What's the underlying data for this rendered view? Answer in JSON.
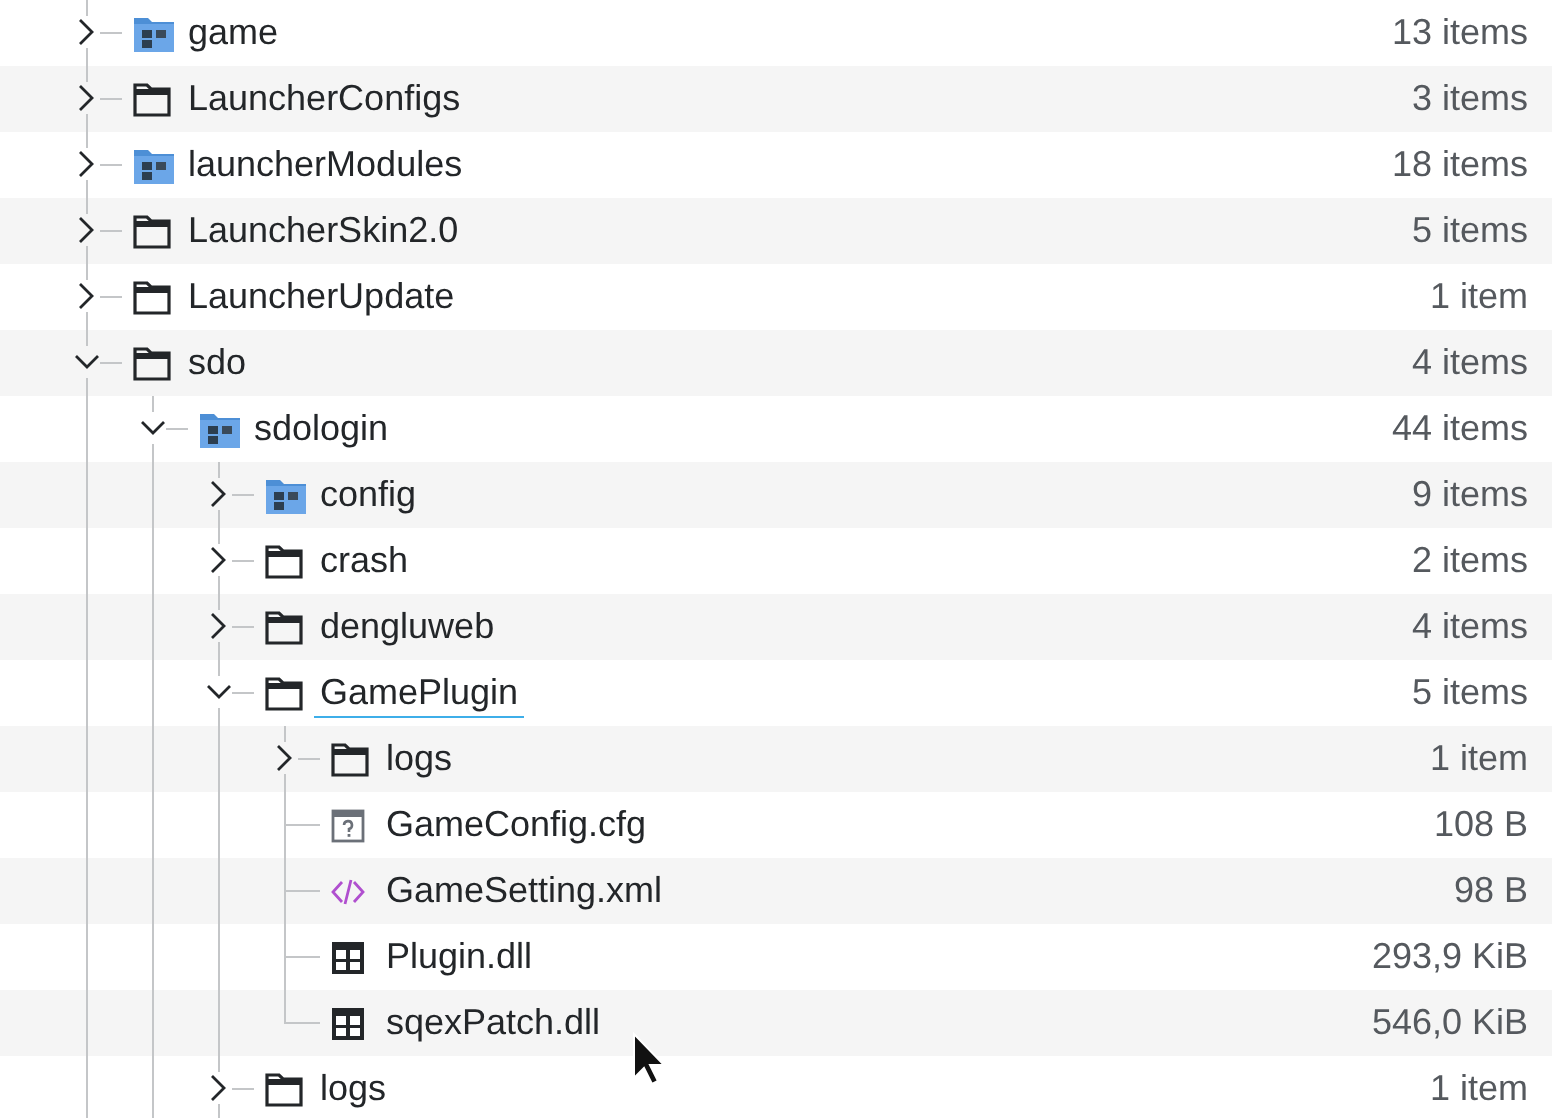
{
  "tree": [
    {
      "kind": "special-folder",
      "name": "game",
      "size": "13 items",
      "expanded": false,
      "focused": false
    },
    {
      "kind": "folder",
      "name": "LauncherConfigs",
      "size": "3 items",
      "expanded": false,
      "focused": false
    },
    {
      "kind": "special-folder",
      "name": "launcherModules",
      "size": "18 items",
      "expanded": false,
      "focused": false
    },
    {
      "kind": "folder",
      "name": "LauncherSkin2.0",
      "size": "5 items",
      "expanded": false,
      "focused": false
    },
    {
      "kind": "folder",
      "name": "LauncherUpdate",
      "size": "1 item",
      "expanded": false,
      "focused": false
    },
    {
      "kind": "folder",
      "name": "sdo",
      "size": "4 items",
      "expanded": true,
      "focused": false,
      "children": [
        {
          "kind": "special-folder",
          "name": "sdologin",
          "size": "44 items",
          "expanded": true,
          "focused": false,
          "children": [
            {
              "kind": "special-folder",
              "name": "config",
              "size": "9 items",
              "expanded": false,
              "focused": false
            },
            {
              "kind": "folder",
              "name": "crash",
              "size": "2 items",
              "expanded": false,
              "focused": false
            },
            {
              "kind": "folder",
              "name": "dengluweb",
              "size": "4 items",
              "expanded": false,
              "focused": false
            },
            {
              "kind": "folder",
              "name": "GamePlugin",
              "size": "5 items",
              "expanded": true,
              "focused": true,
              "children": [
                {
                  "kind": "folder",
                  "name": "logs",
                  "size": "1 item",
                  "expanded": false,
                  "focused": false
                },
                {
                  "kind": "cfg",
                  "name": "GameConfig.cfg",
                  "size": "108 B",
                  "focused": false
                },
                {
                  "kind": "xml",
                  "name": "GameSetting.xml",
                  "size": "98 B",
                  "focused": false
                },
                {
                  "kind": "dll",
                  "name": "Plugin.dll",
                  "size": "293,9 KiB",
                  "focused": false
                },
                {
                  "kind": "dll",
                  "name": "sqexPatch.dll",
                  "size": "546,0 KiB",
                  "focused": false
                }
              ]
            },
            {
              "kind": "folder",
              "name": "logs",
              "size": "1 item",
              "expanded": false,
              "focused": false
            }
          ]
        }
      ]
    }
  ]
}
